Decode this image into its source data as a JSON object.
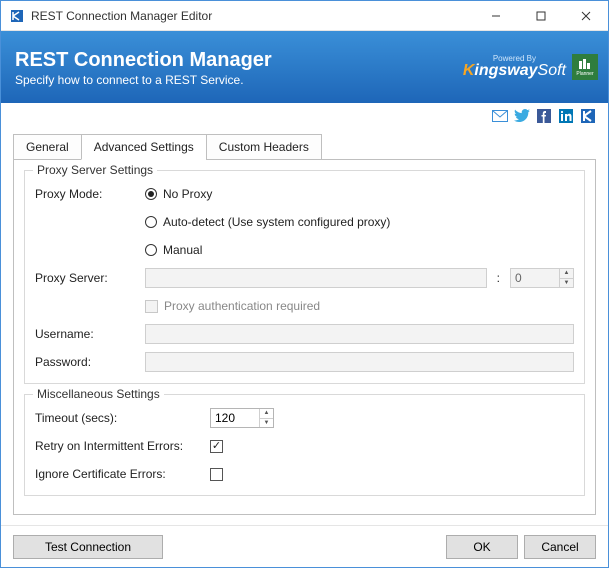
{
  "titlebar": {
    "title": "REST Connection Manager Editor"
  },
  "banner": {
    "title": "REST Connection Manager",
    "subtitle": "Specify how to connect to a REST Service.",
    "powered_by": "Powered By",
    "brand": "KingswaySoft",
    "product": "Planner"
  },
  "tabs": [
    {
      "label": "General",
      "active": false
    },
    {
      "label": "Advanced Settings",
      "active": true
    },
    {
      "label": "Custom Headers",
      "active": false
    }
  ],
  "proxy": {
    "group_label": "Proxy Server Settings",
    "mode_label": "Proxy Mode:",
    "mode_options": {
      "no_proxy": "No Proxy",
      "auto": "Auto-detect (Use system configured proxy)",
      "manual": "Manual"
    },
    "mode_selected": "no_proxy",
    "server_label": "Proxy Server:",
    "server_value": "",
    "port_value": "0",
    "auth_required_label": "Proxy authentication required",
    "auth_required": false,
    "username_label": "Username:",
    "username_value": "",
    "password_label": "Password:",
    "password_value": ""
  },
  "misc": {
    "group_label": "Miscellaneous Settings",
    "timeout_label": "Timeout (secs):",
    "timeout_value": "120",
    "retry_label": "Retry on Intermittent Errors:",
    "retry_checked": true,
    "ignore_cert_label": "Ignore Certificate Errors:",
    "ignore_cert_checked": false
  },
  "footer": {
    "test": "Test Connection",
    "ok": "OK",
    "cancel": "Cancel"
  }
}
